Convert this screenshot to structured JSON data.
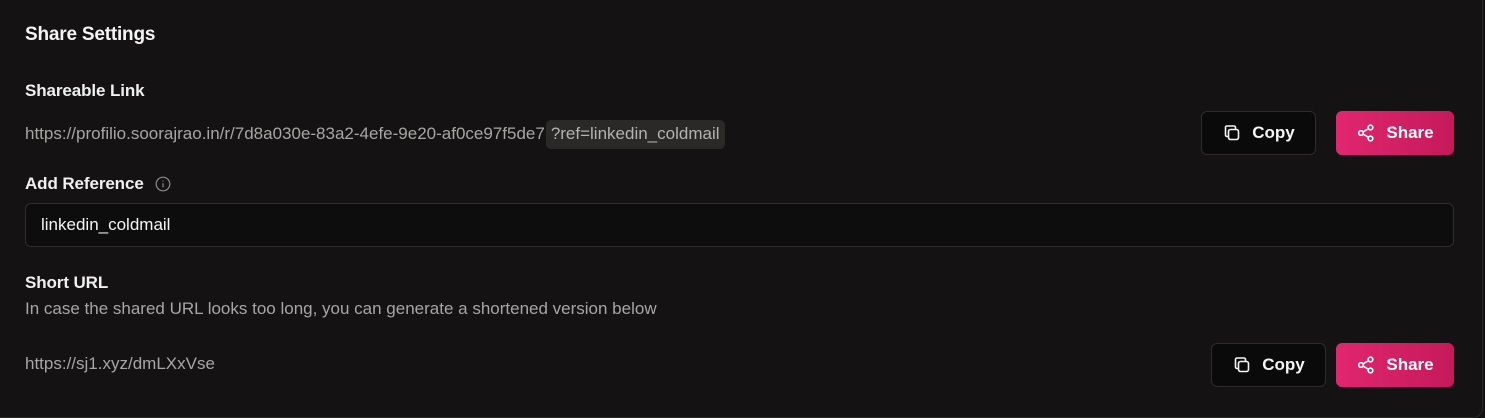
{
  "share_settings": {
    "title": "Share Settings",
    "shareable_link": {
      "label": "Shareable Link",
      "base_url": "https://profilio.soorajrao.in/r/7d8a030e-83a2-4efe-9e20-af0ce97f5de7",
      "ref_query": "?ref=linkedin_coldmail",
      "copy_label": "Copy",
      "share_label": "Share"
    },
    "add_reference": {
      "label": "Add Reference",
      "value": "linkedin_coldmail"
    },
    "short_url": {
      "label": "Short URL",
      "description": "In case the shared URL looks too long, you can generate a shortened version below",
      "url": "https://sj1.xyz/dmLXxVse",
      "copy_label": "Copy",
      "share_label": "Share"
    }
  },
  "icons": {
    "copy": "copy-icon",
    "share": "share-icon",
    "info": "info-icon"
  },
  "colors": {
    "background": "#141212",
    "accent": "#e0266f",
    "muted_text": "#a9a5a5"
  }
}
